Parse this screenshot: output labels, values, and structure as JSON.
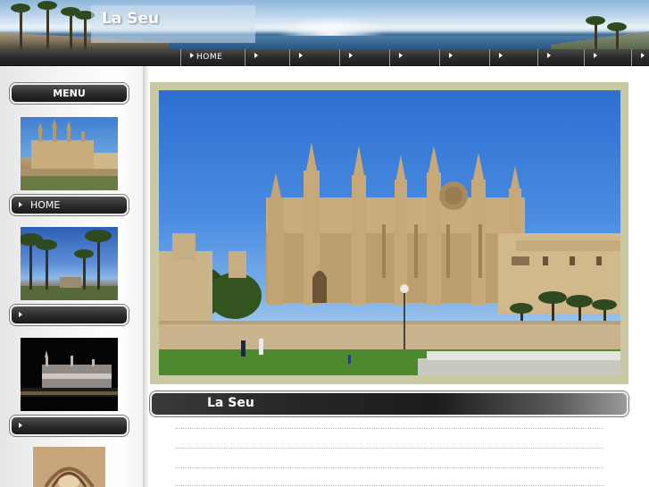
{
  "site": {
    "title": "La Seu"
  },
  "navbar": {
    "items": [
      {
        "label": "HOME"
      },
      {
        "label": ""
      },
      {
        "label": ""
      },
      {
        "label": ""
      },
      {
        "label": ""
      },
      {
        "label": ""
      },
      {
        "label": ""
      },
      {
        "label": ""
      },
      {
        "label": ""
      },
      {
        "label": ""
      }
    ]
  },
  "sidebar": {
    "menu_title": "MENU",
    "links": [
      {
        "label": "HOME"
      },
      {
        "label": ""
      },
      {
        "label": ""
      }
    ]
  },
  "main": {
    "section_title": "La Seu"
  },
  "colors": {
    "nav_bg": "#2c2c2c",
    "hero_frame": "#c9c9a3",
    "sky": "#2c6fd0"
  }
}
